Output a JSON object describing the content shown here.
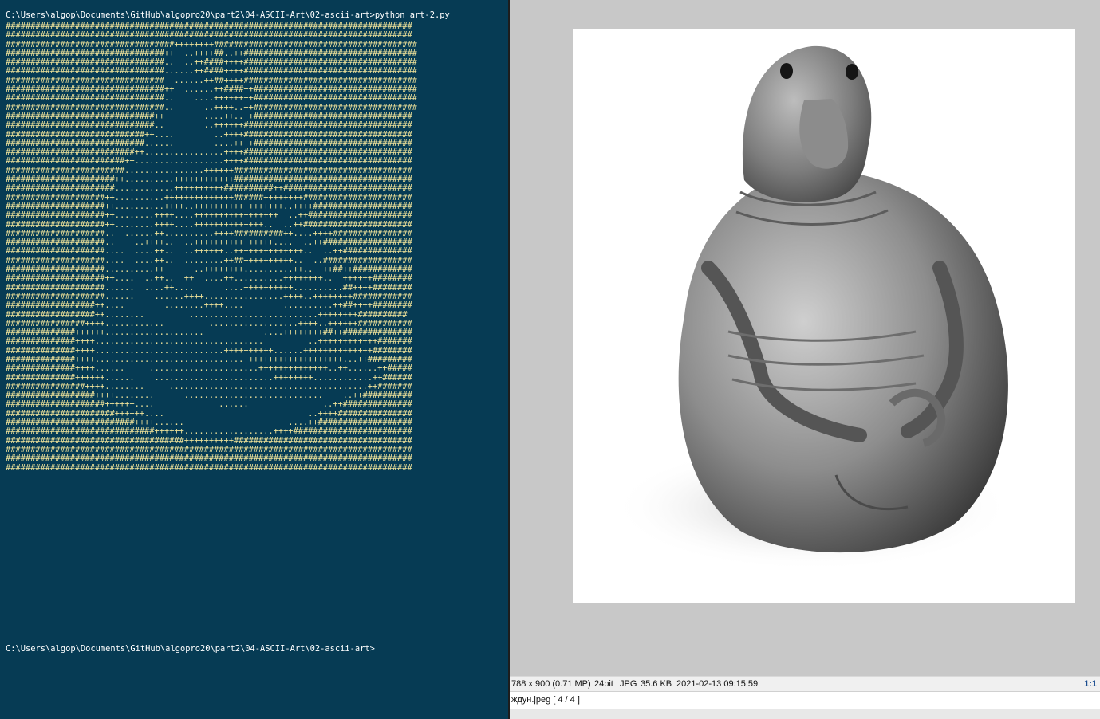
{
  "terminal": {
    "command_line": "C:\\Users\\algop\\Documents\\GitHub\\algopro20\\part2\\04-ASCII-Art\\02-ascii-art>python art-2.py",
    "ascii_lines": [
      "##################################################################################",
      "##################################################################################",
      "##################################++++++++#########################################",
      "################################++  ..++++##..++###################################",
      "################################..  ..++####++++###################################",
      "################################......++####++++###################################",
      "################################  ......++##++++###################################",
      "################################++  ......++####++#################################",
      "################################..    ....++++++++#################################",
      "################################..      ..++++..++#################################",
      "##############################++        ....++..++################################",
      "##############################..        ..++++++##################################",
      "############################++....        ..++++##################################",
      "############################......        ....++++################################",
      "##########################++................++++##################################",
      "########################++..................++++##################################",
      "########################................++++++####################################",
      "######################++..........++++++++++++####################################",
      "######################............++++++++++##########++##########################",
      "####################++..........++++++++++++++######++++++++######################",
      "####################++..........++++..++++++++++++++++++..++++####################",
      "####################++........++++....+++++++++++++++++  ..++#####################",
      "####################++........++++....++++++++++++++..  ..++######################",
      "####################..  ......++..........++++##########++....++++################",
      "####################..    ..++++..  ..++++++++++++++++....  ..++##################",
      "####################....  ....++..  ..++++++..++++++++++++++..  ..++##############",
      "####################....  ....++..  ........++##++++++++++..  ..##################",
      "####################..........++      ..++++++++..........++..  ++##++############",
      "####################++....  ..++..  ++  ....++..........++++++++..  ++++++########",
      "####################......  ....++....      ....++++++++++..........##++++########",
      "####################......    ......++++................++++..++++++++############",
      "##################++....        ........++++....        ..........++##++++########",
      "##################++........         ..........................++++++++##########",
      "################++++............         ..................++++..++++++###########",
      "##############++++++....................            ....++++++++##++##############",
      "##############++++..................................         ..++++++++++++#######",
      "##############++++..........................++++++++++......++++++++++++++########",
      "##############++++..............................++++++++++++++++++++...++#########",
      "##############++++......     ......................++++++++++++++..++......++#####",
      "##############++++++......    ........................++++++++............++######",
      "################++++........     ........................................++#######",
      "##################++++........      ............................    ..++##########",
      "####################++++++....             ......               ..++##############",
      "######################++++++....                             ..++++###############",
      "##########################++++......                     ....++###################",
      "##############################++++++..................++++########################",
      "####################################++++++++++####################################",
      "##################################################################################",
      "##################################################################################",
      "##################################################################################"
    ],
    "prompt_line": "C:\\Users\\algop\\Documents\\GitHub\\algopro20\\part2\\04-ASCII-Art\\02-ascii-art>"
  },
  "viewer": {
    "status": {
      "dimensions": "788 x 900 (0.71 MP)",
      "bitdepth": "24bit",
      "format": "JPG",
      "filesize": "35.6 KB",
      "datetime": "2021-02-13 09:15:59",
      "zoom": "1:1"
    },
    "filename": "ждун.jpeg [ 4 / 4 ]"
  },
  "colors": {
    "terminal_bg": "#063b54",
    "ascii_fg": "#f0e39a",
    "viewer_bg": "#c8c8c8"
  }
}
